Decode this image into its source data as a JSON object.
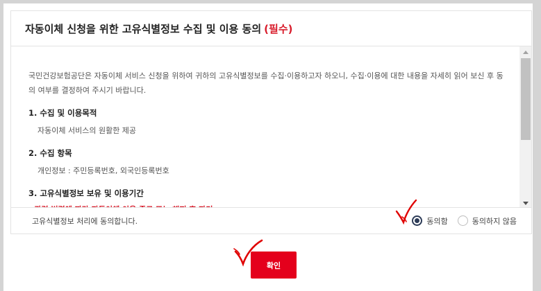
{
  "dialog": {
    "title": "자동이체 신청을 위한 고유식별정보 수집 및 이용 동의",
    "required_tag": "(필수)",
    "intro": "국민건강보험공단은 자동이체 서비스 신청을 위하여 귀하의 고유식별정보를 수집·이용하고자 하오니, 수집·이용에 대한 내용을 자세히 읽어 보신 후 동의 여부를 결정하여 주시기 바랍니다.",
    "sections": [
      {
        "title": "1. 수집 및 이용목적",
        "body": "자동이체 서비스의 원활한 제공"
      },
      {
        "title": "2. 수집 항목",
        "body": "개인정보 : 주민등록번호, 외국인등록번호"
      },
      {
        "title": "3. 고유식별정보 보유 및 이용기간",
        "body": "- 관련 법령에 따라 자동이체 이용 종료 또는 해지 후 파기"
      }
    ],
    "agree_label": "고유식별정보 처리에 동의합니다.",
    "radio_agree": "동의함",
    "radio_disagree": "동의하지 않음",
    "selected": "agree",
    "confirm_label": "확인"
  },
  "colors": {
    "required": "#d81c2b",
    "confirm_button": "#e4001c",
    "annotation_mark": "#e00000"
  }
}
